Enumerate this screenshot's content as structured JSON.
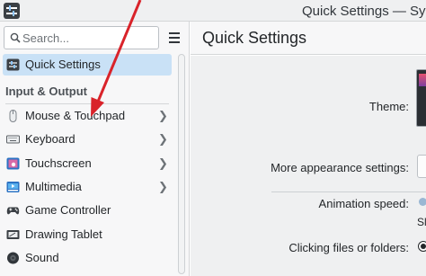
{
  "window": {
    "title": "Quick Settings — Syste"
  },
  "search": {
    "placeholder": "Search..."
  },
  "sidebar": {
    "selected": {
      "label": "Quick Settings"
    },
    "section_title": "Input & Output",
    "items": [
      {
        "label": "Mouse & Touchpad",
        "icon": "mouse-icon",
        "has_children": true
      },
      {
        "label": "Keyboard",
        "icon": "keyboard-icon",
        "has_children": true
      },
      {
        "label": "Touchscreen",
        "icon": "touchscreen-icon",
        "has_children": true
      },
      {
        "label": "Multimedia",
        "icon": "multimedia-icon",
        "has_children": true
      },
      {
        "label": "Game Controller",
        "icon": "game-controller-icon",
        "has_children": false
      },
      {
        "label": "Drawing Tablet",
        "icon": "drawing-tablet-icon",
        "has_children": false
      },
      {
        "label": "Sound",
        "icon": "sound-icon",
        "has_children": false
      }
    ]
  },
  "main": {
    "title": "Quick Settings",
    "settings": {
      "theme_label": "Theme:",
      "more_appearance_label": "More appearance settings:",
      "animation_speed_label": "Animation speed:",
      "animation_speed_value_text": "Sl",
      "clicking_label": "Clicking files or folders:"
    }
  },
  "annotation": {
    "color": "#d9232a"
  },
  "colors": {
    "selection": "#c9e1f6",
    "accent": "#3daee9"
  }
}
